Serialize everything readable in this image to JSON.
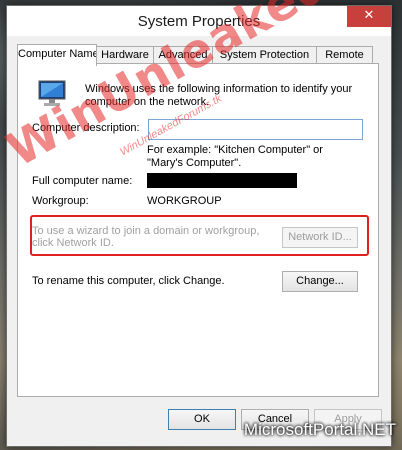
{
  "window": {
    "title": "System Properties",
    "close_glyph": "✕"
  },
  "tabs": [
    {
      "label": "Computer Name",
      "active": true
    },
    {
      "label": "Hardware"
    },
    {
      "label": "Advanced"
    },
    {
      "label": "System Protection"
    },
    {
      "label": "Remote"
    }
  ],
  "panel": {
    "intro_text": "Windows uses the following information to identify your computer on the network.",
    "description_label": "Computer description:",
    "description_value": "",
    "example_text": "For example: \"Kitchen Computer\" or \"Mary's Computer\".",
    "full_name_label": "Full computer name:",
    "full_name_value": "",
    "workgroup_label": "Workgroup:",
    "workgroup_value": "WORKGROUP",
    "domain_text": "To use a wizard to join a domain or workgroup, click Network ID.",
    "network_id_button": "Network ID...",
    "rename_text": "To rename this computer, click Change.",
    "change_button": "Change..."
  },
  "buttons": {
    "ok": "OK",
    "cancel": "Cancel",
    "apply": "Apply"
  },
  "watermark": {
    "main": "WinUnleaked.tk",
    "sub": "WinUnleakedForums.tk"
  },
  "site_badge": "MicrosoftPortal.NET",
  "colors": {
    "highlight_border": "#e0201e",
    "close_button": "#c7403b",
    "watermark": "#e62828"
  },
  "icons": {
    "computer": "computer-monitor-icon"
  }
}
